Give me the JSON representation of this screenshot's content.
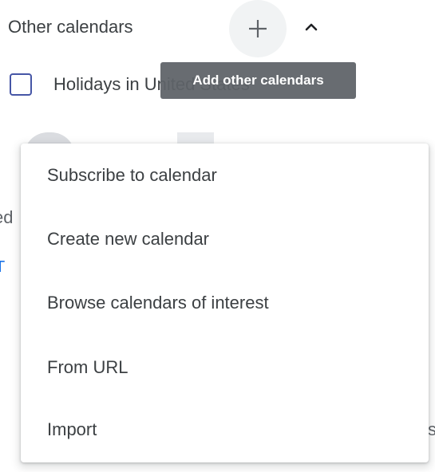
{
  "other_calendars": {
    "title": "Other calendars",
    "add_button_icon": "plus-icon",
    "collapse_icon": "chevron-up-icon"
  },
  "calendar_list": {
    "items": [
      {
        "label": "Holidays in United States",
        "checked": false
      }
    ]
  },
  "tooltip": {
    "text": "Add other calendars"
  },
  "background_fragments": {
    "left_1": "ed",
    "left_2": "T",
    "right_1": "s"
  },
  "add_menu": {
    "items": [
      {
        "label": "Subscribe to calendar"
      },
      {
        "label": "Create new calendar"
      },
      {
        "label": "Browse calendars of interest"
      },
      {
        "label": "From URL"
      },
      {
        "label": "Import"
      }
    ]
  },
  "colors": {
    "text": "#3c4043",
    "checkbox_border": "#4656a6",
    "tooltip_bg": "#5f6368",
    "button_hover_bg": "#f1f3f4",
    "link_blue": "#1a73e8"
  }
}
